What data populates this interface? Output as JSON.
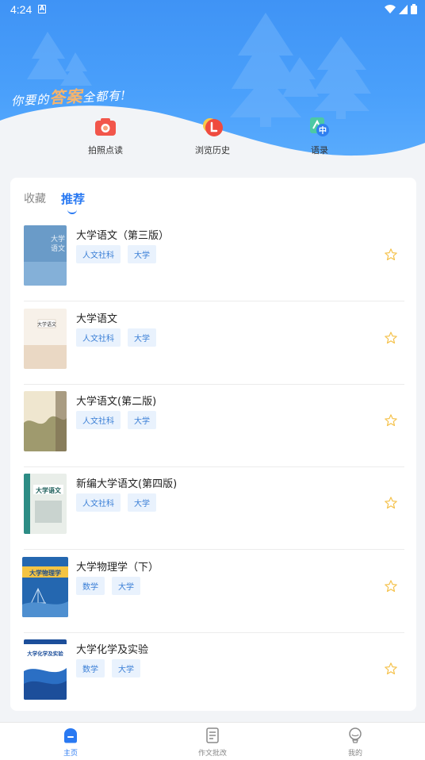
{
  "status_bar": {
    "time": "4:24",
    "a_badge": "A"
  },
  "header": {
    "slogan_prefix": "你要的",
    "slogan_highlight": "答案",
    "slogan_suffix": "全都有!"
  },
  "quick_actions": [
    {
      "label": "拍照点读",
      "icon": "camera-icon"
    },
    {
      "label": "浏览历史",
      "icon": "history-icon"
    },
    {
      "label": "语录",
      "icon": "translate-icon"
    }
  ],
  "tabs": [
    {
      "label": "收藏",
      "active": false
    },
    {
      "label": "推荐",
      "active": true
    }
  ],
  "books": [
    {
      "title": "大学语文（第三版）",
      "tags": [
        "人文社科",
        "大学"
      ]
    },
    {
      "title": "大学语文",
      "tags": [
        "人文社科",
        "大学"
      ]
    },
    {
      "title": "大学语文(第二版)",
      "tags": [
        "人文社科",
        "大学"
      ]
    },
    {
      "title": "新编大学语文(第四版)",
      "tags": [
        "人文社科",
        "大学"
      ]
    },
    {
      "title": "大学物理学（下）",
      "tags": [
        "数学",
        "大学"
      ]
    },
    {
      "title": "大学化学及实验",
      "tags": [
        "数学",
        "大学"
      ]
    }
  ],
  "bottom_nav": [
    {
      "label": "主页",
      "active": true,
      "icon": "home-icon"
    },
    {
      "label": "作文批改",
      "active": false,
      "icon": "document-icon"
    },
    {
      "label": "我的",
      "active": false,
      "icon": "profile-icon"
    }
  ],
  "colors": {
    "accent": "#2979f2",
    "header_blue": "#4aa0fb",
    "star": "#f5c24c"
  }
}
